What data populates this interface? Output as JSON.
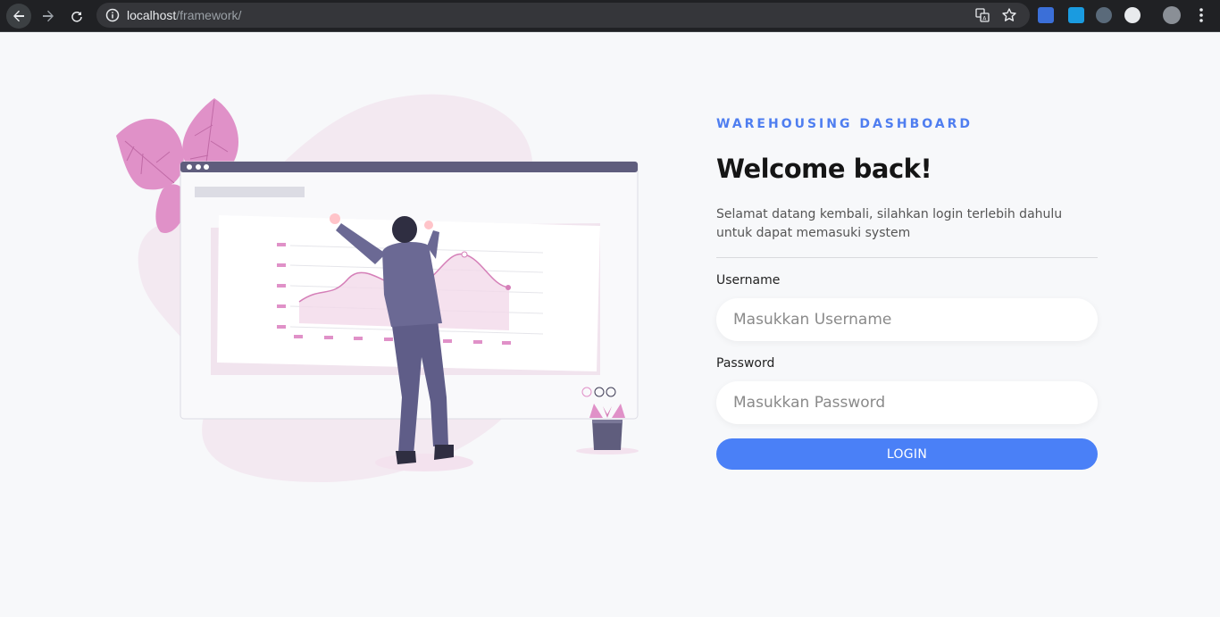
{
  "browser": {
    "url_host": "localhost",
    "url_path": "/framework/"
  },
  "login": {
    "kicker": "WAREHOUSING DASHBOARD",
    "title": "Welcome back!",
    "description": "Selamat datang kembali, silahkan login terlebih dahulu untuk dapat memasuki system",
    "username_label": "Username",
    "username_placeholder": "Masukkan Username",
    "username_value": "",
    "password_label": "Password",
    "password_placeholder": "Masukkan Password",
    "password_value": "",
    "button_label": "LOGIN"
  },
  "colors": {
    "accent": "#4a80f7",
    "kicker": "#4f7ef0",
    "illustration_pink": "#e091c8",
    "illustration_purple": "#5f5d7d",
    "background": "#f7f8fa"
  },
  "icons": [
    "back-arrow-icon",
    "forward-arrow-icon",
    "reload-icon",
    "info-icon",
    "translate-icon",
    "star-icon",
    "extension-icon",
    "menu-dots-icon"
  ]
}
